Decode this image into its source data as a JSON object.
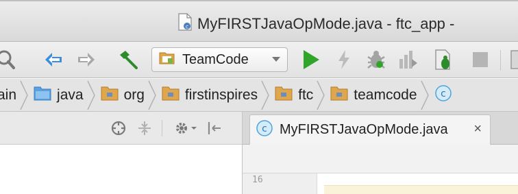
{
  "window": {
    "title": "MyFIRSTJavaOpMode.java - ftc_app -"
  },
  "toolbar": {
    "run_config_label": "TeamCode",
    "icons": [
      "search-icon",
      "back-icon",
      "forward-icon",
      "make-hammer-icon",
      "android-module-icon",
      "run-icon",
      "apply-changes-icon",
      "debug-icon",
      "profile-icon",
      "attach-debugger-icon",
      "stop-icon"
    ]
  },
  "breadcrumb": {
    "items": [
      {
        "label": "ain"
      },
      {
        "label": "java"
      },
      {
        "label": "org"
      },
      {
        "label": "firstinspires"
      },
      {
        "label": "ftc"
      },
      {
        "label": "teamcode"
      }
    ]
  },
  "editor": {
    "tab_label": "MyFIRSTJavaOpMode.java",
    "tab_close": "×",
    "line_number": "16"
  },
  "colors": {
    "run_green": "#2fa52a",
    "back_blue": "#3a8fd8",
    "folder_orange": "#e0a64b",
    "folder_blue": "#5aa1e0",
    "class_blue": "#4aa3df",
    "highlight": "#faf3d9"
  }
}
